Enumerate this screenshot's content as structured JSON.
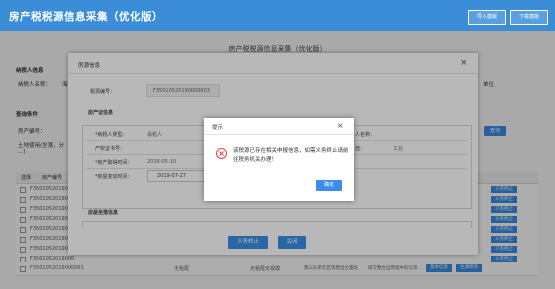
{
  "header": {
    "title": "房产税税源信息采集（优化版）",
    "import_label": "导入模版",
    "download_label": "下载模版"
  },
  "background": {
    "heading": "房产税税源信息采集（优化版）",
    "taxpayer_section": "纳税人信息",
    "taxpayer_name_label": "纳税人名称：",
    "taxpayer_name_value": "海",
    "taxpayer_unit": "单位",
    "query_section": "查询条件",
    "property_no_label": "房产编号：",
    "land_label": "土地使用(坐落，分",
    "land_label_tail": "...)",
    "query_button": "查询",
    "grid_header_select": "选择",
    "grid_header_no": "房产编号",
    "rows": [
      {
        "id": "F3501052019000"
      },
      {
        "id": "F3501052019000"
      },
      {
        "id": "F3501052019000"
      },
      {
        "id": "F3501052019000"
      },
      {
        "id": "F3501052019000"
      },
      {
        "id": "F3501052019000"
      },
      {
        "id": "F3501052019000"
      },
      {
        "id": "F3501052019000"
      },
      {
        "id": "F3501052019000001"
      }
    ],
    "row_btn1": "",
    "row_btn2": "义务终止",
    "last_row": {
      "c1": "无租尾",
      "c2": "无租尾无视模",
      "c3": "我三队单元区等我出位置处",
      "c4": "提交整合运营理中的信息...",
      "btn1": "基本信息",
      "btn2": "生源修改"
    }
  },
  "modal": {
    "title": "房源信息",
    "close": "×",
    "source_no_label": "税源编号：",
    "source_no_value": "F35010520190000003",
    "cert_section": "房产证信息",
    "taxpayer_type_label": "*纳税人类型：",
    "taxpayer_type_value": "承租人",
    "cert_no_label": "产权证书号：",
    "acquire_time_label": "*房产取得时间：",
    "acquire_time_value": "2016-05-10",
    "change_time_label": "*房屋变动时间：",
    "change_time_value": "2019-07-27",
    "owner_name_label": "人名称：",
    "usage_label": "途：",
    "usage_value": "工业",
    "location_section": "房屋坐落信息",
    "stop_button": "义务终止",
    "close_button": "关闭"
  },
  "alert": {
    "title": "提示",
    "close": "×",
    "message": "该税源已存在相关申报信息，如需义务终止请前往税务机关办理！",
    "ok_label": "确定",
    "error_color": "#e0463b"
  }
}
